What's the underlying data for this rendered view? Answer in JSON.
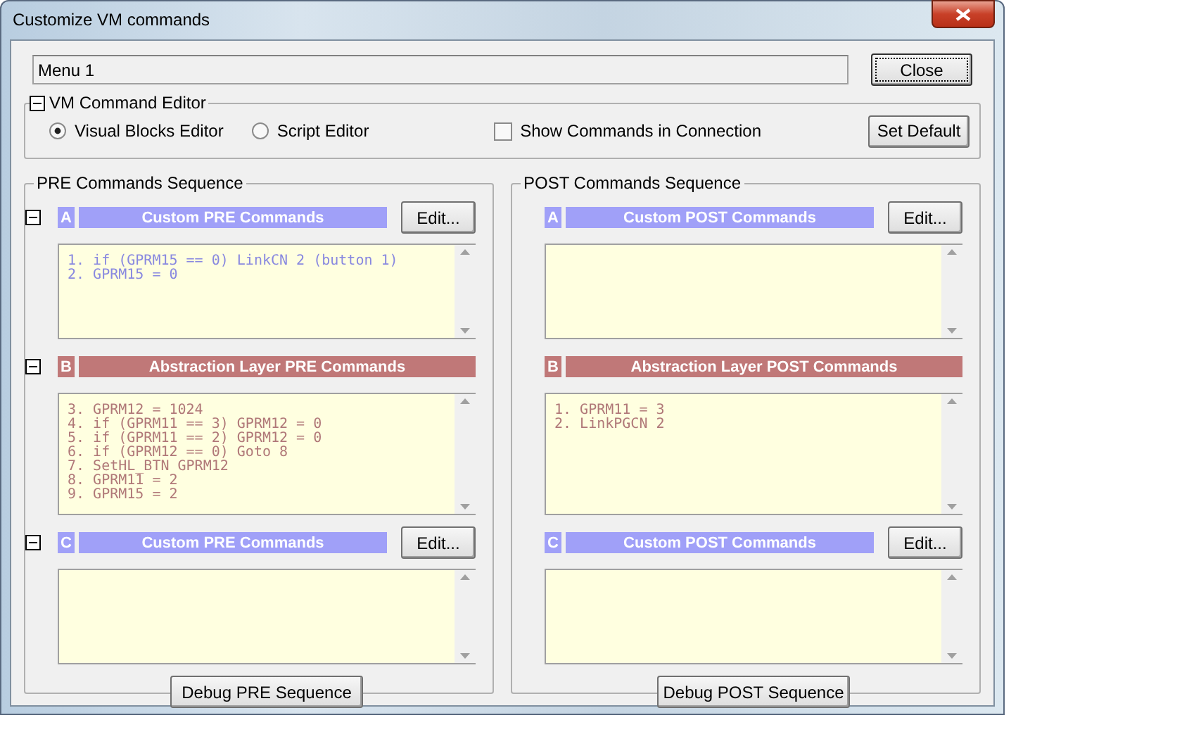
{
  "window": {
    "title": "Customize VM commands"
  },
  "menu_field": {
    "value": "Menu 1"
  },
  "close_button": "Close",
  "editor_group": {
    "title": "VM Command Editor",
    "expanded": true,
    "modes": [
      {
        "label": "Visual Blocks Editor",
        "selected": true
      },
      {
        "label": "Script Editor",
        "selected": false
      }
    ],
    "show_commands": {
      "label": "Show Commands in Connection",
      "checked": false
    },
    "set_default": "Set Default"
  },
  "sequences": [
    {
      "title": "PRE Commands Sequence",
      "debug_button": "Debug PRE Sequence",
      "blocks": [
        {
          "letter": "A",
          "kind": "custom",
          "title": "Custom PRE Commands",
          "expanded": true,
          "edit": "Edit...",
          "lines": [
            "1. if (GPRM15 == 0) LinkCN 2 (button 1)",
            "2. GPRM15 = 0"
          ]
        },
        {
          "letter": "B",
          "kind": "abstraction",
          "title": "Abstraction Layer PRE Commands",
          "expanded": true,
          "lines": [
            "3. GPRM12 = 1024",
            "4. if (GPRM11 == 3) GPRM12 = 0",
            "5. if (GPRM11 == 2) GPRM12 = 0",
            "6. if (GPRM12 == 0) Goto 8",
            "7. SetHL_BTN GPRM12",
            "8. GPRM11 = 2",
            "9. GPRM15 = 2"
          ]
        },
        {
          "letter": "C",
          "kind": "custom",
          "title": "Custom PRE Commands",
          "expanded": true,
          "edit": "Edit..."
        }
      ]
    },
    {
      "title": "POST Commands Sequence",
      "debug_button": "Debug POST Sequence",
      "blocks": [
        {
          "letter": "A",
          "kind": "custom",
          "title": "Custom POST Commands",
          "edit": "Edit..."
        },
        {
          "letter": "B",
          "kind": "abstraction",
          "title": "Abstraction Layer POST Commands",
          "lines": [
            "1. GPRM11 = 3",
            "2. LinkPGCN 2"
          ]
        },
        {
          "letter": "C",
          "kind": "custom",
          "title": "Custom POST Commands",
          "edit": "Edit..."
        }
      ]
    }
  ]
}
